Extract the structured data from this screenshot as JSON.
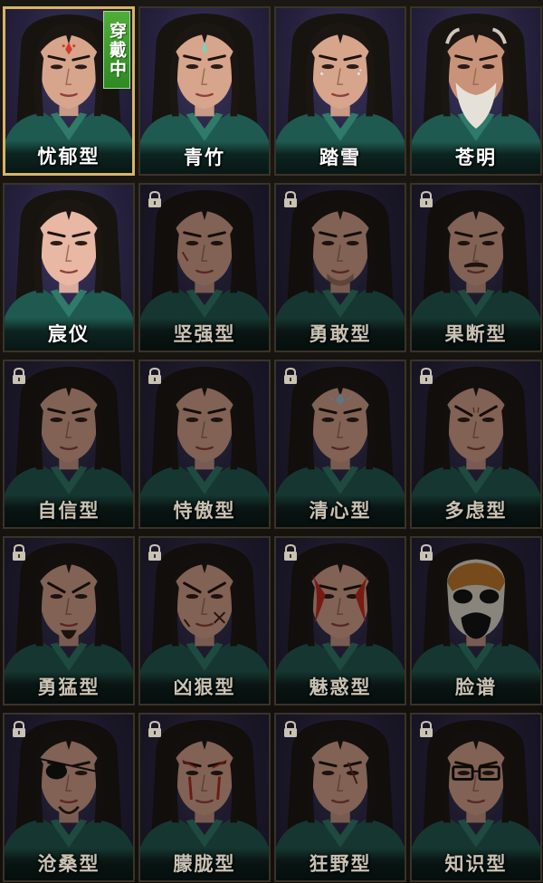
{
  "screen": {
    "title": "",
    "equipped_badge": "穿戴中",
    "colors": {
      "frame": "#3a3328",
      "selected_frame": "#d8b466",
      "badge_green": "#3f9f2e",
      "background_purple": "#2a2540"
    },
    "styles": [
      {
        "label": "忧郁型",
        "locked": false,
        "selected": true,
        "feature": "red-forehead-mark"
      },
      {
        "label": "青竹",
        "locked": false,
        "selected": false,
        "feature": "teal-forehead-mark"
      },
      {
        "label": "踏雪",
        "locked": false,
        "selected": false,
        "feature": "silver-eye-marks"
      },
      {
        "label": "苍明",
        "locked": false,
        "selected": false,
        "feature": "white-beard-elder"
      },
      {
        "label": "宸仪",
        "locked": false,
        "selected": false,
        "feature": "plain"
      },
      {
        "label": "坚强型",
        "locked": true,
        "selected": false,
        "feature": "cheek-scar"
      },
      {
        "label": "勇敢型",
        "locked": true,
        "selected": false,
        "feature": "light-stubble"
      },
      {
        "label": "果断型",
        "locked": true,
        "selected": false,
        "feature": "moustache"
      },
      {
        "label": "自信型",
        "locked": true,
        "selected": false,
        "feature": "plain"
      },
      {
        "label": "恃傲型",
        "locked": true,
        "selected": false,
        "feature": "plain"
      },
      {
        "label": "清心型",
        "locked": true,
        "selected": false,
        "feature": "forehead-gem"
      },
      {
        "label": "多虑型",
        "locked": true,
        "selected": false,
        "feature": "furrowed-brow"
      },
      {
        "label": "勇猛型",
        "locked": true,
        "selected": false,
        "feature": "chin-beard"
      },
      {
        "label": "凶狠型",
        "locked": true,
        "selected": false,
        "feature": "cross-scars"
      },
      {
        "label": "魅惑型",
        "locked": true,
        "selected": false,
        "feature": "red-face-paint"
      },
      {
        "label": "脸谱",
        "locked": true,
        "selected": false,
        "feature": "opera-mask"
      },
      {
        "label": "沧桑型",
        "locked": true,
        "selected": false,
        "feature": "eye-patch"
      },
      {
        "label": "朦胧型",
        "locked": true,
        "selected": false,
        "feature": "red-streak-paint"
      },
      {
        "label": "狂野型",
        "locked": true,
        "selected": false,
        "feature": "eye-scar"
      },
      {
        "label": "知识型",
        "locked": true,
        "selected": false,
        "feature": "glasses"
      }
    ]
  }
}
